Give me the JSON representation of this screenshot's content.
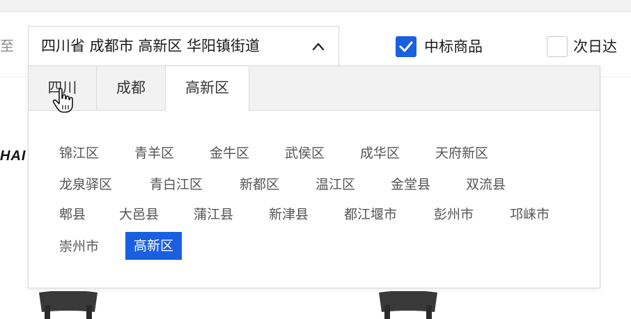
{
  "ship_to_label": "至",
  "address_select": {
    "value": "四川省 成都市 高新区 华阳镇街道",
    "expanded_icon": "chevron-up-icon"
  },
  "filters": {
    "bid_goods": {
      "label": "中标商品",
      "checked": true
    },
    "next_day": {
      "label": "次日达",
      "checked": false
    }
  },
  "background": {
    "logo_fragment": "HAI"
  },
  "region_picker": {
    "tabs": [
      {
        "label": "四川",
        "active": false
      },
      {
        "label": "成都",
        "active": false
      },
      {
        "label": "高新区",
        "active": true
      }
    ],
    "options": [
      "锦江区",
      "青羊区",
      "金牛区",
      "武侯区",
      "成华区",
      "天府新区",
      "龙泉驿区",
      "青白江区",
      "新都区",
      "温江区",
      "金堂县",
      "双流县",
      "郫县",
      "大邑县",
      "蒲江县",
      "新津县",
      "都江堰市",
      "彭州市",
      "邛崃市",
      "崇州市",
      "高新区"
    ],
    "selected": "高新区"
  },
  "colors": {
    "accent": "#1a5fe0",
    "tab_bar": "#f2f2f2"
  }
}
